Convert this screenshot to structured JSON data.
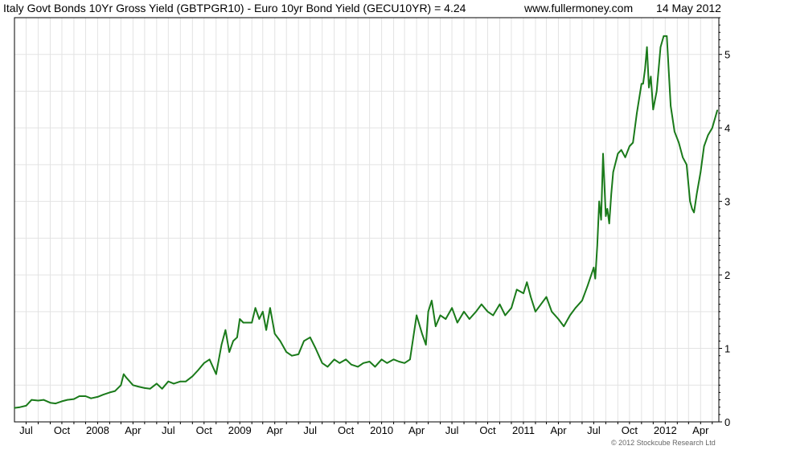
{
  "header": {
    "title": "Italy Govt Bonds 10Yr Gross Yield (GBTPGR10) - Euro 10yr Bond Yield (GECU10YR) = 4.24",
    "site": "www.fullermoney.com",
    "date": "14 May 2012"
  },
  "footer": {
    "credit": "© 2012 Stockcube Research Ltd"
  },
  "chart_data": {
    "type": "line",
    "title": "Italy Govt Bonds 10Yr Gross Yield (GBTPGR10) - Euro 10yr Bond Yield (GECU10YR) = 4.24",
    "xlabel": "",
    "ylabel": "",
    "ylim": [
      0,
      5.5
    ],
    "y_ticks": [
      0,
      1,
      2,
      3,
      4,
      5
    ],
    "x_tick_labels": [
      "Jul",
      "Oct",
      "2008",
      "Apr",
      "Jul",
      "Oct",
      "2009",
      "Apr",
      "Jul",
      "Oct",
      "2010",
      "Apr",
      "Jul",
      "Oct",
      "2011",
      "Apr",
      "Jul",
      "Oct",
      "2012",
      "Apr"
    ],
    "grid": true,
    "line_color": "#1a7a1a",
    "series": [
      {
        "name": "",
        "x": [
          "2007-06-01",
          "2007-06-15",
          "2007-07-01",
          "2007-07-15",
          "2007-08-01",
          "2007-08-15",
          "2007-09-01",
          "2007-09-15",
          "2007-10-01",
          "2007-10-15",
          "2007-11-01",
          "2007-11-15",
          "2007-12-01",
          "2007-12-15",
          "2008-01-01",
          "2008-01-15",
          "2008-02-01",
          "2008-02-15",
          "2008-03-01",
          "2008-03-08",
          "2008-03-15",
          "2008-04-01",
          "2008-04-15",
          "2008-05-01",
          "2008-05-15",
          "2008-06-01",
          "2008-06-15",
          "2008-07-01",
          "2008-07-15",
          "2008-08-01",
          "2008-08-15",
          "2008-09-01",
          "2008-09-15",
          "2008-10-01",
          "2008-10-15",
          "2008-11-01",
          "2008-11-15",
          "2008-11-25",
          "2008-12-05",
          "2008-12-15",
          "2008-12-25",
          "2009-01-01",
          "2009-01-10",
          "2009-01-20",
          "2009-02-01",
          "2009-02-10",
          "2009-02-20",
          "2009-03-01",
          "2009-03-10",
          "2009-03-20",
          "2009-04-01",
          "2009-04-15",
          "2009-05-01",
          "2009-05-15",
          "2009-06-01",
          "2009-06-15",
          "2009-07-01",
          "2009-07-15",
          "2009-08-01",
          "2009-08-15",
          "2009-09-01",
          "2009-09-15",
          "2009-10-01",
          "2009-10-15",
          "2009-11-01",
          "2009-11-15",
          "2009-12-01",
          "2009-12-15",
          "2010-01-01",
          "2010-01-15",
          "2010-02-01",
          "2010-02-15",
          "2010-03-01",
          "2010-03-15",
          "2010-04-01",
          "2010-04-15",
          "2010-04-25",
          "2010-05-01",
          "2010-05-10",
          "2010-05-20",
          "2010-06-01",
          "2010-06-15",
          "2010-07-01",
          "2010-07-15",
          "2010-08-01",
          "2010-08-15",
          "2010-09-01",
          "2010-09-15",
          "2010-10-01",
          "2010-10-15",
          "2010-11-01",
          "2010-11-15",
          "2010-12-01",
          "2010-12-15",
          "2011-01-01",
          "2011-01-10",
          "2011-01-20",
          "2011-02-01",
          "2011-02-15",
          "2011-03-01",
          "2011-03-15",
          "2011-04-01",
          "2011-04-15",
          "2011-05-01",
          "2011-05-15",
          "2011-06-01",
          "2011-06-15",
          "2011-07-01",
          "2011-07-05",
          "2011-07-10",
          "2011-07-15",
          "2011-07-20",
          "2011-07-25",
          "2011-08-01",
          "2011-08-05",
          "2011-08-10",
          "2011-08-15",
          "2011-08-20",
          "2011-09-01",
          "2011-09-10",
          "2011-09-20",
          "2011-10-01",
          "2011-10-10",
          "2011-10-20",
          "2011-11-01",
          "2011-11-05",
          "2011-11-10",
          "2011-11-15",
          "2011-11-20",
          "2011-11-25",
          "2011-12-01",
          "2011-12-10",
          "2011-12-20",
          "2011-12-28",
          "2012-01-05",
          "2012-01-15",
          "2012-01-25",
          "2012-02-05",
          "2012-02-15",
          "2012-02-25",
          "2012-03-05",
          "2012-03-10",
          "2012-03-15",
          "2012-03-22",
          "2012-04-01",
          "2012-04-10",
          "2012-04-20",
          "2012-05-01",
          "2012-05-14"
        ],
        "values": [
          0.19,
          0.2,
          0.22,
          0.3,
          0.29,
          0.3,
          0.26,
          0.25,
          0.28,
          0.3,
          0.31,
          0.35,
          0.35,
          0.32,
          0.34,
          0.37,
          0.4,
          0.42,
          0.5,
          0.65,
          0.6,
          0.5,
          0.48,
          0.46,
          0.45,
          0.52,
          0.45,
          0.55,
          0.52,
          0.55,
          0.55,
          0.62,
          0.7,
          0.8,
          0.85,
          0.65,
          1.05,
          1.25,
          0.95,
          1.1,
          1.15,
          1.4,
          1.35,
          1.35,
          1.35,
          1.55,
          1.4,
          1.5,
          1.25,
          1.55,
          1.2,
          1.1,
          0.95,
          0.9,
          0.92,
          1.1,
          1.15,
          1.0,
          0.8,
          0.75,
          0.85,
          0.8,
          0.85,
          0.78,
          0.75,
          0.8,
          0.82,
          0.75,
          0.85,
          0.8,
          0.85,
          0.82,
          0.8,
          0.85,
          1.45,
          1.2,
          1.05,
          1.5,
          1.65,
          1.3,
          1.45,
          1.4,
          1.55,
          1.35,
          1.5,
          1.4,
          1.5,
          1.6,
          1.5,
          1.45,
          1.6,
          1.45,
          1.55,
          1.8,
          1.75,
          1.9,
          1.7,
          1.5,
          1.6,
          1.7,
          1.5,
          1.4,
          1.3,
          1.45,
          1.55,
          1.65,
          1.85,
          2.1,
          1.95,
          2.4,
          3.0,
          2.75,
          3.65,
          2.8,
          2.9,
          2.7,
          3.1,
          3.4,
          3.65,
          3.7,
          3.6,
          3.75,
          3.8,
          4.2,
          4.6,
          4.6,
          4.8,
          5.1,
          4.55,
          4.7,
          4.25,
          4.5,
          5.1,
          5.25,
          5.25,
          4.3,
          3.95,
          3.8,
          3.6,
          3.5,
          3.0,
          2.9,
          2.85,
          3.1,
          3.4,
          3.75,
          3.9,
          4.0,
          4.24
        ]
      }
    ]
  }
}
